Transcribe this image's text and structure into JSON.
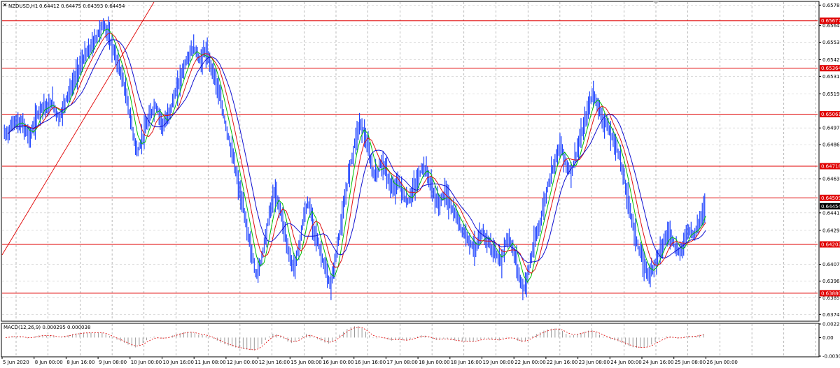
{
  "header": {
    "symbol_label": "NZDUSD,H1",
    "ohlc_label": "0.64412 0.64475 0.64393 0.64454"
  },
  "macd_label": "MACD(12,26,9) 0.000295 0.000038",
  "colors": {
    "candles": "#1f44ff",
    "ma_fast": "#00c000",
    "ma_mid": "#e01010",
    "ma_slow": "#1010d0",
    "level": "#e00000",
    "trendline": "#e00000",
    "grid": "#c8c8c8",
    "current_price_tag": "#000000"
  },
  "chart_data": [
    {
      "type": "line",
      "title": "NZDUSD,H1",
      "grid": true,
      "x_ticks": [
        "5 Jun 2020",
        "8 Jun 00:00",
        "8 Jun 16:00",
        "9 Jun 08:00",
        "10 Jun 00:00",
        "10 Jun 16:00",
        "11 Jun 08:00",
        "12 Jun 00:00",
        "12 Jun 16:00",
        "15 Jun 08:00",
        "16 Jun 00:00",
        "16 Jun 16:00",
        "17 Jun 08:00",
        "18 Jun 00:00",
        "18 Jun 16:00",
        "19 Jun 08:00",
        "22 Jun 00:00",
        "22 Jun 16:00",
        "23 Jun 08:00",
        "24 Jun 00:00",
        "24 Jun 16:00",
        "25 Jun 08:00",
        "26 Jun 00:00"
      ],
      "y_ticks": [
        "0.65780",
        "0.65645",
        "0.65535",
        "0.65420",
        "0.65310",
        "0.65195",
        "0.64970",
        "0.64860",
        "0.64635",
        "0.64410",
        "0.64295",
        "0.64070",
        "0.63960",
        "0.63850",
        "0.63740"
      ],
      "ylim": [
        0.637,
        0.658
      ],
      "horizontal_levels": [
        "0.65677",
        "0.65364",
        "0.65061",
        "0.64718",
        "0.64509",
        "0.64202",
        "0.63880"
      ],
      "current_price": "0.64454",
      "series": [
        {
          "kind": "candles_close",
          "values": [
            0.6493,
            0.6498,
            0.6502,
            0.6499,
            0.65,
            0.6495,
            0.6491,
            0.6497,
            0.6505,
            0.651,
            0.6512,
            0.6509,
            0.6515,
            0.6508,
            0.6503,
            0.651,
            0.6518,
            0.6522,
            0.6528,
            0.6535,
            0.654,
            0.6545,
            0.6548,
            0.6552,
            0.6557,
            0.6562,
            0.6565,
            0.656,
            0.6552,
            0.6545,
            0.6538,
            0.653,
            0.6518,
            0.6505,
            0.6492,
            0.648,
            0.6488,
            0.6495,
            0.6502,
            0.6508,
            0.6512,
            0.6505,
            0.6498,
            0.6503,
            0.651,
            0.6518,
            0.6525,
            0.6533,
            0.654,
            0.6545,
            0.655,
            0.6547,
            0.654,
            0.6548,
            0.6544,
            0.6537,
            0.653,
            0.652,
            0.6508,
            0.6497,
            0.6486,
            0.6475,
            0.6462,
            0.645,
            0.6438,
            0.6425,
            0.6412,
            0.64,
            0.6406,
            0.6418,
            0.6432,
            0.6445,
            0.6455,
            0.6448,
            0.6438,
            0.6425,
            0.6412,
            0.6405,
            0.6412,
            0.6425,
            0.644,
            0.6448,
            0.6438,
            0.6427,
            0.6418,
            0.641,
            0.64,
            0.6392,
            0.6405,
            0.642,
            0.6435,
            0.645,
            0.6468,
            0.648,
            0.6492,
            0.65,
            0.6495,
            0.6485,
            0.6472,
            0.6465,
            0.647,
            0.6475,
            0.6468,
            0.646,
            0.6455,
            0.6462,
            0.6458,
            0.645,
            0.6448,
            0.6455,
            0.646,
            0.6466,
            0.6472,
            0.6468,
            0.646,
            0.6452,
            0.6447,
            0.645,
            0.6455,
            0.6448,
            0.6442,
            0.6438,
            0.6432,
            0.6428,
            0.6425,
            0.642,
            0.6418,
            0.6422,
            0.6428,
            0.6424,
            0.642,
            0.6416,
            0.6412,
            0.6408,
            0.642,
            0.6425,
            0.6418,
            0.641,
            0.6398,
            0.639,
            0.6398,
            0.641,
            0.6422,
            0.643,
            0.644,
            0.6452,
            0.6463,
            0.6472,
            0.648,
            0.6485,
            0.6478,
            0.647,
            0.6468,
            0.6478,
            0.6487,
            0.6495,
            0.6505,
            0.6515,
            0.652,
            0.6512,
            0.6505,
            0.65,
            0.6496,
            0.649,
            0.6485,
            0.6478,
            0.6465,
            0.6452,
            0.644,
            0.6428,
            0.6418,
            0.641,
            0.6404,
            0.64,
            0.6405,
            0.6412,
            0.6418,
            0.6422,
            0.6428,
            0.6425,
            0.6418,
            0.6414,
            0.642,
            0.6428,
            0.643,
            0.6426,
            0.6432,
            0.644,
            0.6445
          ]
        },
        {
          "kind": "ma_fast"
        },
        {
          "kind": "ma_mid"
        },
        {
          "kind": "ma_slow"
        }
      ]
    },
    {
      "type": "line",
      "title": "MACD(12,26,9)",
      "y_ticks": [
        "0.002212",
        "0.00",
        "-0.00303"
      ],
      "ylim": [
        -0.00303,
        0.002212
      ],
      "series": [
        {
          "name": "MACD",
          "kind": "histogram"
        },
        {
          "name": "Signal",
          "kind": "dotted_line"
        }
      ]
    }
  ]
}
